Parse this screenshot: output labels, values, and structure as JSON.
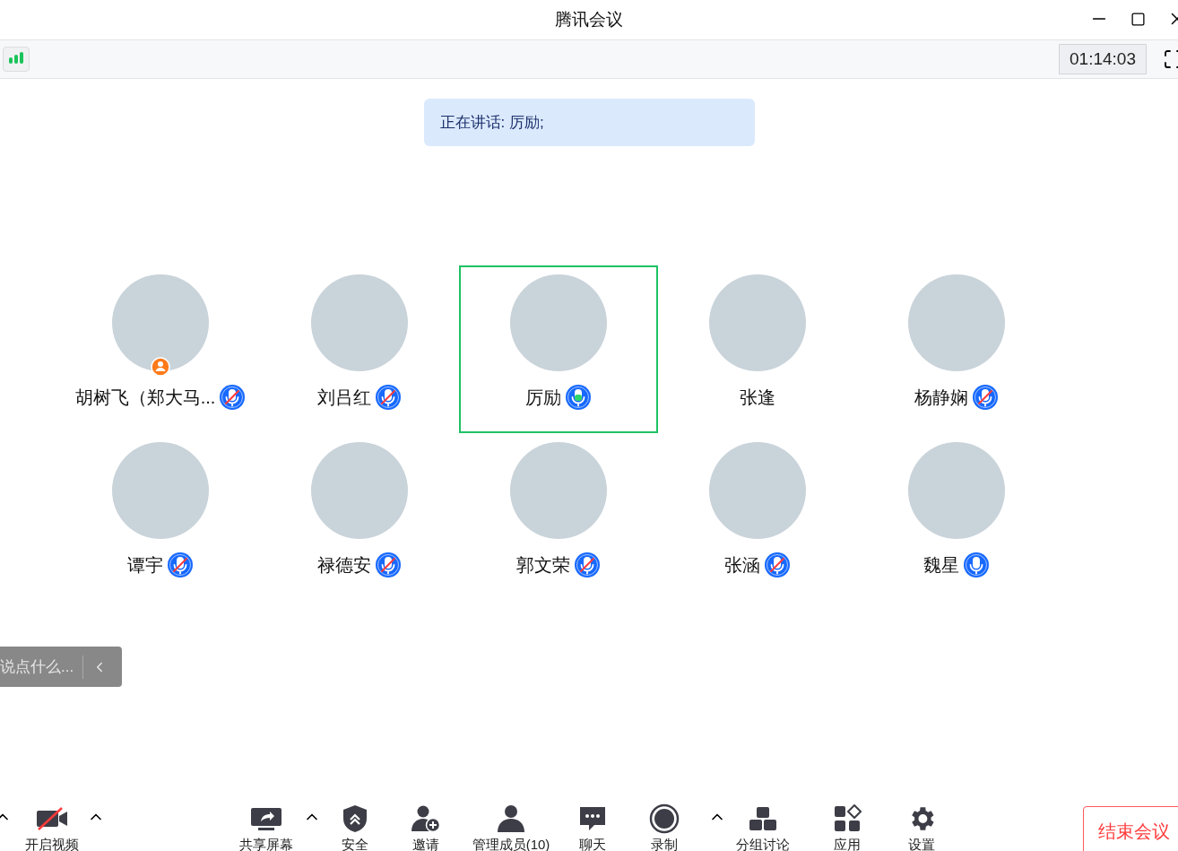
{
  "window": {
    "title": "腾讯会议"
  },
  "timer": "01:14:03",
  "speaking_banner": "正在讲话: 厉励;",
  "participants": [
    {
      "name": "胡树飞（郑大马...",
      "kind": "muted",
      "host": true,
      "selected": false
    },
    {
      "name": "刘吕红",
      "kind": "muted",
      "host": false,
      "selected": false
    },
    {
      "name": "厉励",
      "kind": "speaking",
      "host": false,
      "selected": true
    },
    {
      "name": "张逢",
      "kind": "none",
      "host": false,
      "selected": false
    },
    {
      "name": "杨静娴",
      "kind": "muted",
      "host": false,
      "selected": false
    },
    {
      "name": "谭宇",
      "kind": "muted",
      "host": false,
      "selected": false
    },
    {
      "name": "禄德安",
      "kind": "muted",
      "host": false,
      "selected": false
    },
    {
      "name": "郭文荣",
      "kind": "muted",
      "host": false,
      "selected": false
    },
    {
      "name": "张涵",
      "kind": "muted",
      "host": false,
      "selected": false
    },
    {
      "name": "魏星",
      "kind": "on",
      "host": false,
      "selected": false
    }
  ],
  "chat_input": {
    "placeholder": "说点什么..."
  },
  "toolbar": [
    {
      "kind": "caret"
    },
    {
      "kind": "video",
      "label": "开启视频"
    },
    {
      "kind": "caret"
    },
    {
      "kind": "share",
      "label": "共享屏幕"
    },
    {
      "kind": "caret"
    },
    {
      "kind": "security",
      "label": "安全"
    },
    {
      "kind": "invite",
      "label": "邀请"
    },
    {
      "kind": "members",
      "label": "管理成员(10)"
    },
    {
      "kind": "chat",
      "label": "聊天"
    },
    {
      "kind": "record",
      "label": "录制"
    },
    {
      "kind": "caret"
    },
    {
      "kind": "breakout",
      "label": "分组讨论"
    },
    {
      "kind": "apps",
      "label": "应用"
    },
    {
      "kind": "settings",
      "label": "设置"
    }
  ],
  "end_button": "结束会议"
}
